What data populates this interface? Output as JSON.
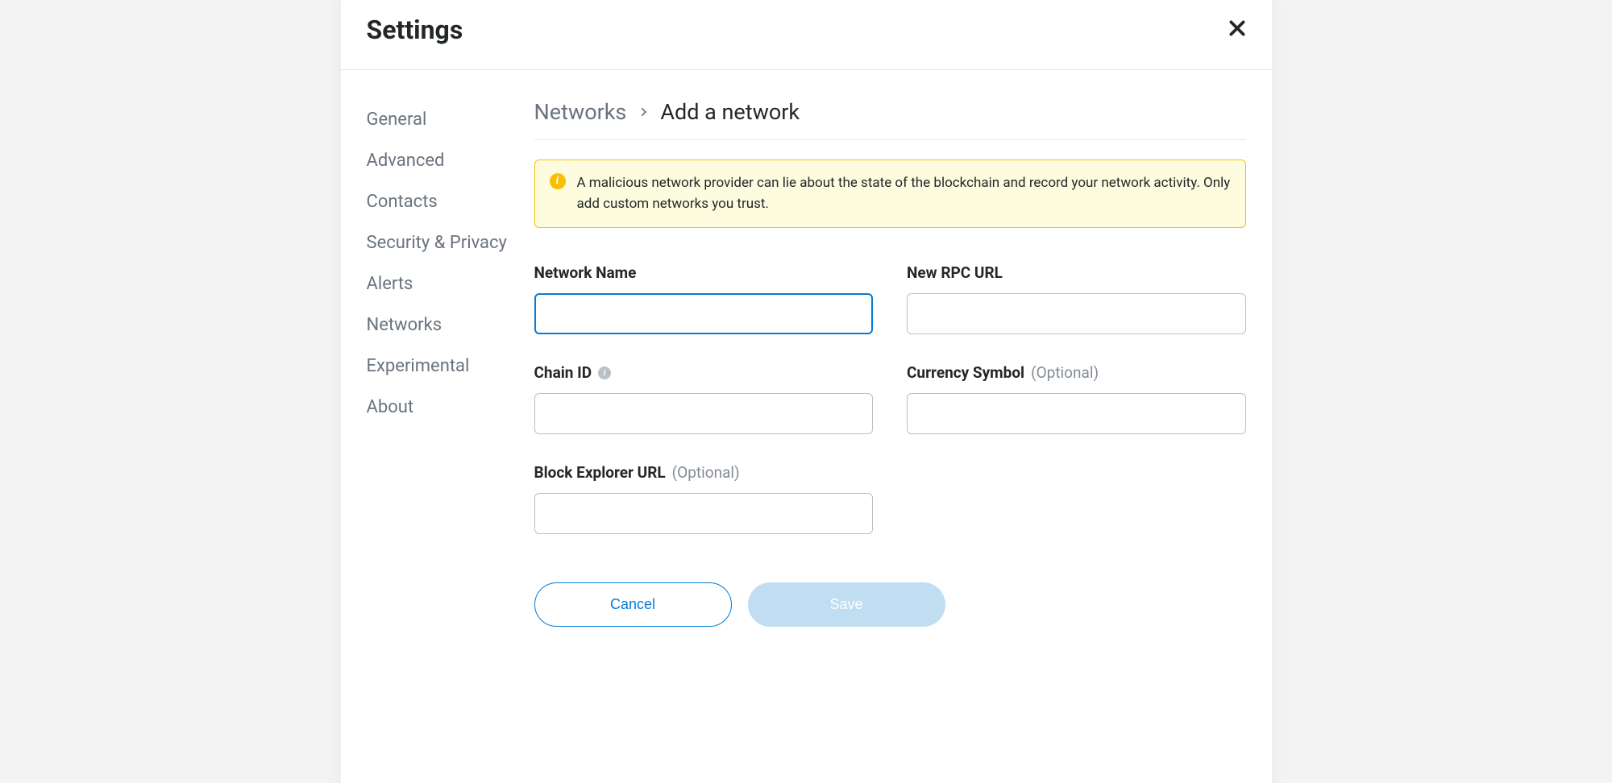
{
  "modal": {
    "title": "Settings"
  },
  "sidebar": {
    "items": [
      {
        "label": "General"
      },
      {
        "label": "Advanced"
      },
      {
        "label": "Contacts"
      },
      {
        "label": "Security & Privacy"
      },
      {
        "label": "Alerts"
      },
      {
        "label": "Networks"
      },
      {
        "label": "Experimental"
      },
      {
        "label": "About"
      }
    ]
  },
  "breadcrumb": {
    "parent": "Networks",
    "current": "Add a network"
  },
  "warning": {
    "text": "A malicious network provider can lie about the state of the blockchain and record your network activity. Only add custom networks you trust."
  },
  "form": {
    "network_name": {
      "label": "Network Name",
      "value": ""
    },
    "rpc_url": {
      "label": "New RPC URL",
      "value": ""
    },
    "chain_id": {
      "label": "Chain ID",
      "value": ""
    },
    "currency_symbol": {
      "label": "Currency Symbol",
      "optional": "(Optional)",
      "value": ""
    },
    "block_explorer": {
      "label": "Block Explorer URL",
      "optional": "(Optional)",
      "value": ""
    }
  },
  "buttons": {
    "cancel": "Cancel",
    "save": "Save"
  }
}
